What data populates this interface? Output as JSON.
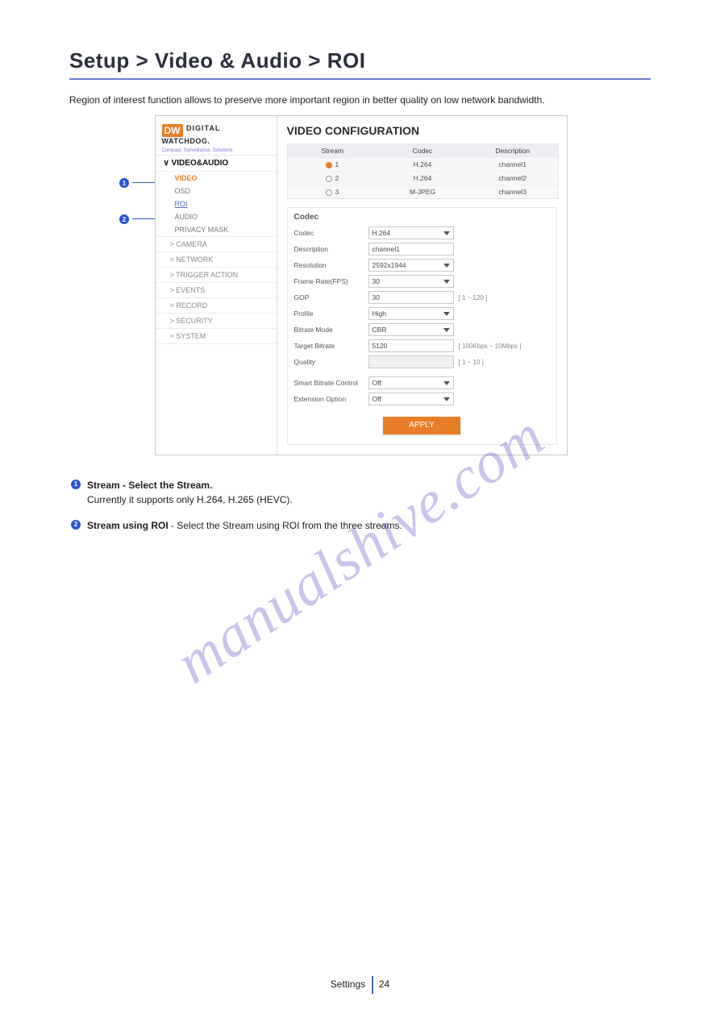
{
  "page": {
    "title": "Setup > Video & Audio > ROI",
    "intro": "Region of interest function allows to preserve more important region in better quality on low network bandwidth.",
    "footer_left": "Settings",
    "footer_right": "24",
    "watermark": "manualshive.com"
  },
  "callouts": {
    "one_num": "1",
    "two_num": "2"
  },
  "shot": {
    "logo": {
      "badge": "DW",
      "line1": "DIGITAL",
      "line2": "WATCHDOG.",
      "tag": "Compact. Surveillance. Solutions"
    },
    "side": {
      "video_audio": "∨ VIDEO&AUDIO",
      "video": "VIDEO",
      "osd": "OSD",
      "roi": "ROI",
      "audio": "AUDIO",
      "privacy": "PRIVACY MASK",
      "camera": "> CAMERA",
      "network": "> NETWORK",
      "trigger": "> TRIGGER ACTION",
      "events": "> EVENTS",
      "record": "> RECORD",
      "security": "> SECURITY",
      "system": "> SYSTEM"
    },
    "main": {
      "title": "VIDEO CONFIGURATION",
      "streams_header": {
        "stream": "Stream",
        "codec": "Codec",
        "desc": "Description"
      },
      "streams": [
        {
          "n": "1",
          "codec": "H.264",
          "desc": "channel1",
          "selected": true
        },
        {
          "n": "2",
          "codec": "H.264",
          "desc": "channel2",
          "selected": false
        },
        {
          "n": "3",
          "codec": "M-JPEG",
          "desc": "channel3",
          "selected": false
        }
      ],
      "codec": {
        "group": "Codec",
        "rows": {
          "codec": {
            "label": "Codec",
            "value": "H.264",
            "type": "select"
          },
          "description": {
            "label": "Description",
            "value": "channel1",
            "type": "text"
          },
          "resolution": {
            "label": "Resolution",
            "value": "2592x1944",
            "type": "select"
          },
          "framerate": {
            "label": "Frame Rate(FPS)",
            "value": "30",
            "type": "select"
          },
          "gop": {
            "label": "GOP",
            "value": "30",
            "type": "text",
            "hint": "[ 1 ~ 120 ]"
          },
          "profile": {
            "label": "Profile",
            "value": "High",
            "type": "select"
          },
          "bitmode": {
            "label": "Bitrate Mode",
            "value": "CBR",
            "type": "select"
          },
          "target": {
            "label": "Target Bitrate",
            "value": "5120",
            "type": "text",
            "hint": "[ 100Kbps ~ 10Mbps ]"
          },
          "quality": {
            "label": "Quality",
            "value": "",
            "type": "disabled",
            "hint": "[ 1 ~ 10 ]"
          },
          "smart": {
            "label": "Smart Bitrate Control",
            "value": "Off",
            "type": "select"
          },
          "ext": {
            "label": "Extension Option",
            "value": "Off",
            "type": "select"
          }
        },
        "apply": "APPLY"
      }
    }
  },
  "body": {
    "b1_num": "1",
    "b1_text": "Stream - Select the Stream.",
    "b1_note": "Currently it supports only H.264, H.265 (HEVC).",
    "b2_num": "2",
    "b2_text_strong": "Stream using ROI",
    "b2_text_rest": " - Select the Stream using ROI from the three streams."
  }
}
